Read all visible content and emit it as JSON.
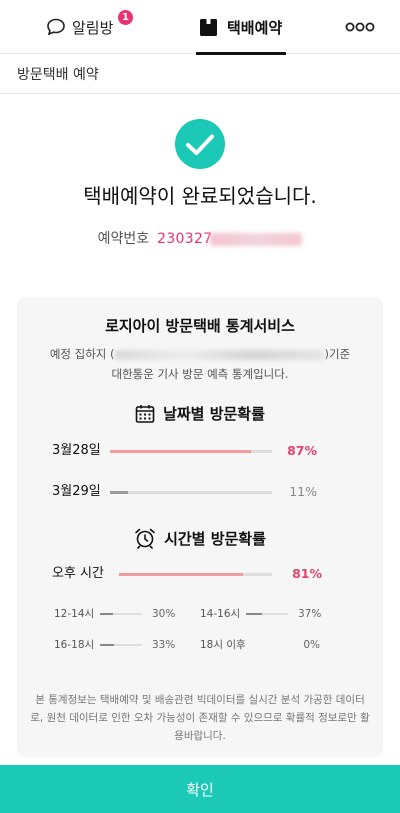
{
  "tabs": {
    "chat_label": "알림방",
    "chat_badge": "1",
    "parcel_label": "택배예약"
  },
  "subheader": {
    "title": "방문택배 예약"
  },
  "result": {
    "title": "택배예약이 완료되었습니다.",
    "number_label": "예약번호",
    "number_visible": "230327"
  },
  "stats": {
    "title": "로지아이 방문택배 통계서비스",
    "desc_prefix": "예정 집하지 (",
    "desc_suffix": ")기준",
    "desc_line2": "대한통운 기사 방문 예측 통계입니다.",
    "date_section": {
      "title": "날짜별 방문확률",
      "rows": [
        {
          "label": "3월28일",
          "value": 87,
          "value_text": "87%"
        },
        {
          "label": "3월29일",
          "value": 11,
          "value_text": "11%"
        }
      ]
    },
    "time_section": {
      "title": "시간별 방문확률",
      "main": {
        "label": "오후 시간",
        "value": 81,
        "value_text": "81%"
      },
      "slots": [
        {
          "label": "12-14시",
          "value": 30,
          "value_text": "30%"
        },
        {
          "label": "14-16시",
          "value": 37,
          "value_text": "37%"
        },
        {
          "label": "16-18시",
          "value": 33,
          "value_text": "33%"
        },
        {
          "label": "18시 이후",
          "value": 0,
          "value_text": "0%"
        }
      ]
    },
    "notice": "본 통계정보는 택배예약 및 배송관련 빅데이터를 실시간 분석 가공한 데이터로, 원천 데이터로 인한 오차 가능성이 존재할 수 있으므로 확률적 정보로만 활용바랍니다."
  },
  "confirm_label": "확인",
  "colors": {
    "accent": "#1cc9b7",
    "pink": "#e8336e",
    "bar_pink": "#f19aa0"
  },
  "icons": [
    "chat-bubble-icon",
    "box-icon",
    "more-icon",
    "check-circle-icon",
    "calendar-icon",
    "alarm-clock-icon"
  ]
}
